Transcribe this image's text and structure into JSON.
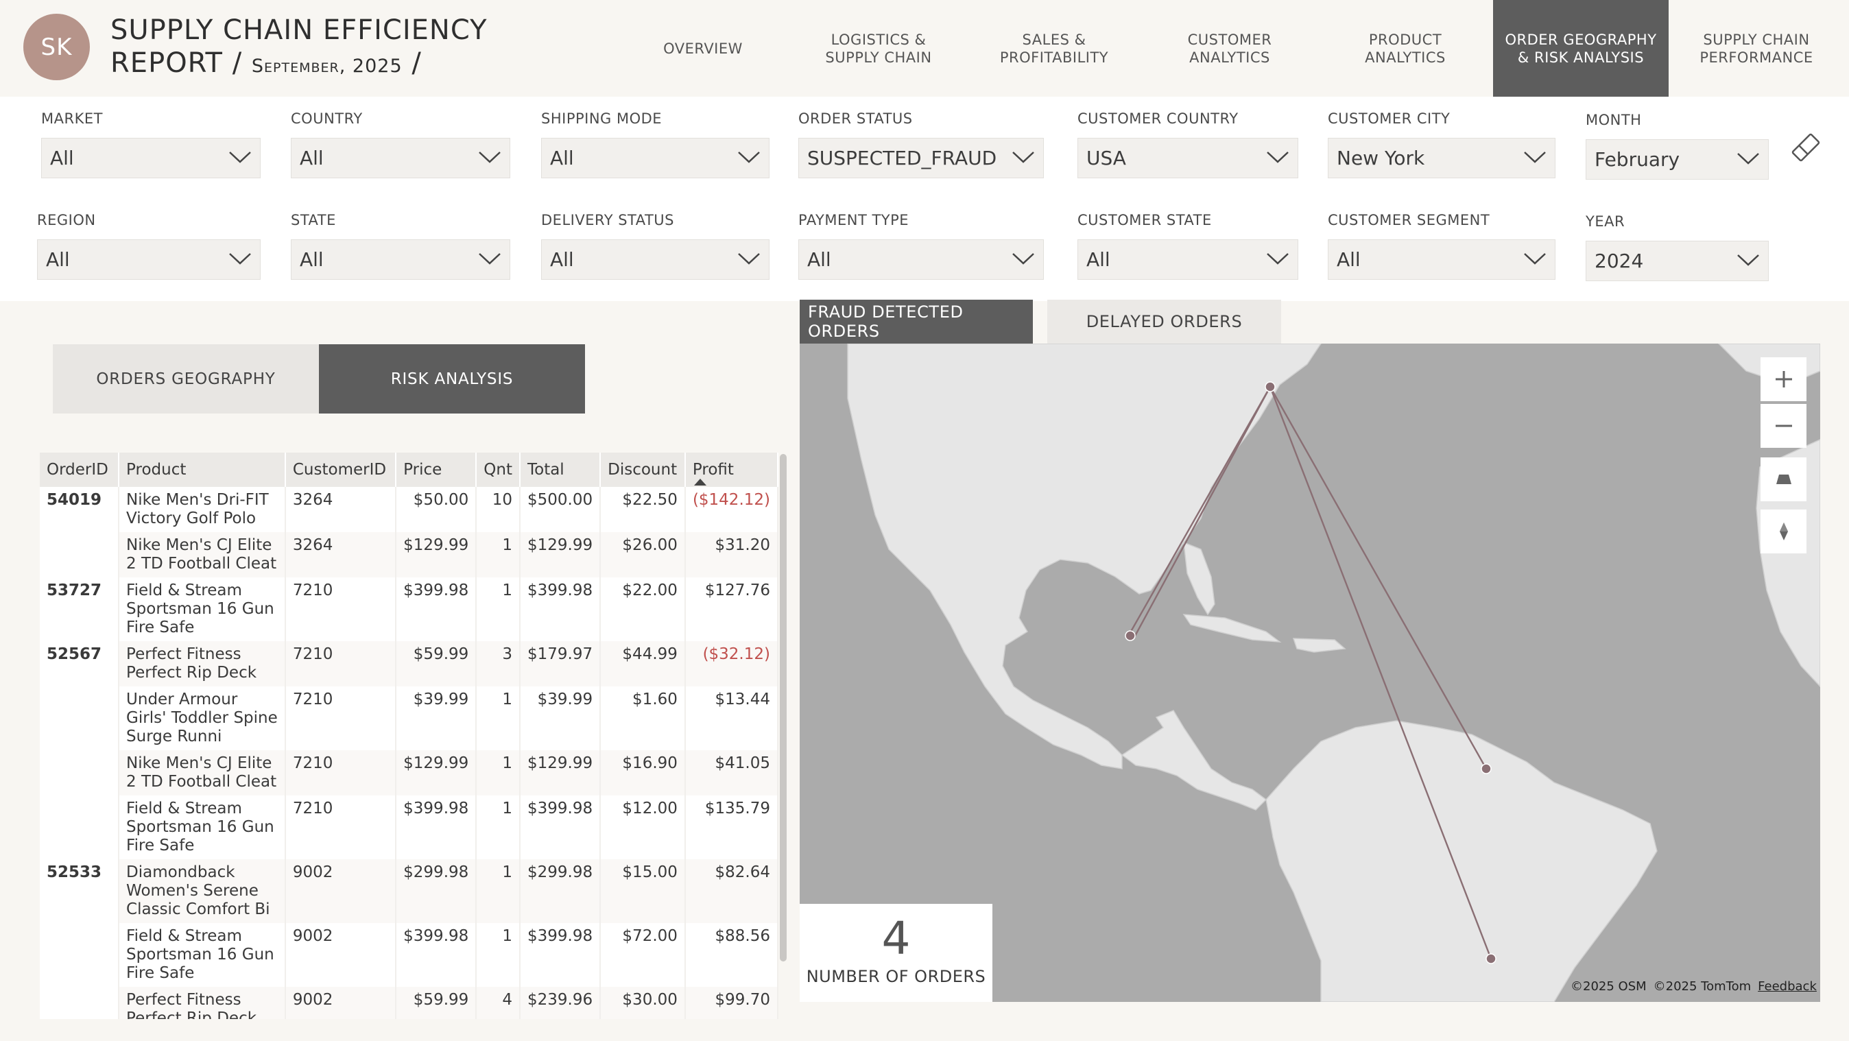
{
  "header": {
    "avatar_initials": "SK",
    "title_line1": "SUPPLY CHAIN EFFICIENCY",
    "title_line2": "REPORT /",
    "title_date": "September, 2025",
    "title_slash": "/"
  },
  "nav": [
    {
      "label": "OVERVIEW",
      "active": false
    },
    {
      "label": "LOGISTICS &\nSUPPLY CHAIN",
      "active": false
    },
    {
      "label": "SALES &\nPROFITABILITY",
      "active": false
    },
    {
      "label": "CUSTOMER\nANALYTICS",
      "active": false
    },
    {
      "label": "PRODUCT\nANALYTICS",
      "active": false
    },
    {
      "label": "ORDER GEOGRAPHY\n& RISK ANALYSIS",
      "active": true
    },
    {
      "label": "SUPPLY CHAIN\nPERFORMANCE",
      "active": false
    }
  ],
  "filters": {
    "market": {
      "label": "MARKET",
      "value": "All"
    },
    "country": {
      "label": "COUNTRY",
      "value": "All"
    },
    "shipping_mode": {
      "label": "SHIPPING MODE",
      "value": "All"
    },
    "order_status": {
      "label": "ORDER STATUS",
      "value": "SUSPECTED_FRAUD"
    },
    "customer_country": {
      "label": "CUSTOMER COUNTRY",
      "value": "USA"
    },
    "customer_city": {
      "label": "CUSTOMER CITY",
      "value": "New York"
    },
    "month": {
      "label": "MONTH",
      "value": "February"
    },
    "region": {
      "label": "REGION",
      "value": "All"
    },
    "state": {
      "label": "STATE",
      "value": "All"
    },
    "delivery_status": {
      "label": "DELIVERY STATUS",
      "value": "All"
    },
    "payment_type": {
      "label": "PAYMENT TYPE",
      "value": "All"
    },
    "customer_state": {
      "label": "CUSTOMER STATE",
      "value": "All"
    },
    "customer_segment": {
      "label": "CUSTOMER SEGMENT",
      "value": "All"
    },
    "year": {
      "label": "YEAR",
      "value": "2024"
    }
  },
  "toggle": {
    "geography": "ORDERS GEOGRAPHY",
    "risk": "RISK ANALYSIS"
  },
  "table": {
    "columns": [
      "OrderID",
      "Product",
      "CustomerID",
      "Price",
      "Qnt",
      "Total",
      "Discount",
      "Profit"
    ],
    "rows": [
      {
        "order_id": "54019",
        "product": "Nike Men's Dri-FIT Victory Golf Polo",
        "customer_id": "3264",
        "price": "$50.00",
        "qnt": "10",
        "total": "$500.00",
        "discount": "$22.50",
        "profit": "($142.12)"
      },
      {
        "order_id": "",
        "product": "Nike Men's CJ Elite 2 TD Football Cleat",
        "customer_id": "3264",
        "price": "$129.99",
        "qnt": "1",
        "total": "$129.99",
        "discount": "$26.00",
        "profit": "$31.20"
      },
      {
        "order_id": "53727",
        "product": "Field & Stream Sportsman 16 Gun Fire Safe",
        "customer_id": "7210",
        "price": "$399.98",
        "qnt": "1",
        "total": "$399.98",
        "discount": "$22.00",
        "profit": "$127.76"
      },
      {
        "order_id": "52567",
        "product": "Perfect Fitness Perfect Rip Deck",
        "customer_id": "7210",
        "price": "$59.99",
        "qnt": "3",
        "total": "$179.97",
        "discount": "$44.99",
        "profit": "($32.12)"
      },
      {
        "order_id": "",
        "product": "Under Armour Girls' Toddler Spine Surge Runni",
        "customer_id": "7210",
        "price": "$39.99",
        "qnt": "1",
        "total": "$39.99",
        "discount": "$1.60",
        "profit": "$13.44"
      },
      {
        "order_id": "",
        "product": "Nike Men's CJ Elite 2 TD Football Cleat",
        "customer_id": "7210",
        "price": "$129.99",
        "qnt": "1",
        "total": "$129.99",
        "discount": "$16.90",
        "profit": "$41.05"
      },
      {
        "order_id": "",
        "product": "Field & Stream Sportsman 16 Gun Fire Safe",
        "customer_id": "7210",
        "price": "$399.98",
        "qnt": "1",
        "total": "$399.98",
        "discount": "$12.00",
        "profit": "$135.79"
      },
      {
        "order_id": "52533",
        "product": "Diamondback Women's Serene Classic Comfort Bi",
        "customer_id": "9002",
        "price": "$299.98",
        "qnt": "1",
        "total": "$299.98",
        "discount": "$15.00",
        "profit": "$82.64"
      },
      {
        "order_id": "",
        "product": "Field & Stream Sportsman 16 Gun Fire Safe",
        "customer_id": "9002",
        "price": "$399.98",
        "qnt": "1",
        "total": "$399.98",
        "discount": "$72.00",
        "profit": "$88.56"
      },
      {
        "order_id": "",
        "product": "Perfect Fitness Perfect Rip Deck",
        "customer_id": "9002",
        "price": "$59.99",
        "qnt": "4",
        "total": "$239.96",
        "discount": "$30.00",
        "profit": "$99.70"
      }
    ]
  },
  "map_tabs": {
    "fraud": "FRAUD DETECTED ORDERS",
    "delayed": "DELAYED ORDERS"
  },
  "map": {
    "origin": "New York",
    "destinations_count": 4,
    "attribution_osm": "©2025 OSM",
    "attribution_tomtom": "©2025 TomTom",
    "feedback": "Feedback"
  },
  "kpi": {
    "value": "4",
    "label": "NUMBER OF ORDERS"
  },
  "colors": {
    "accent": "#5d5d5d",
    "avatar": "#b6948a",
    "negative": "#c0504d",
    "route": "#8a6f74"
  }
}
